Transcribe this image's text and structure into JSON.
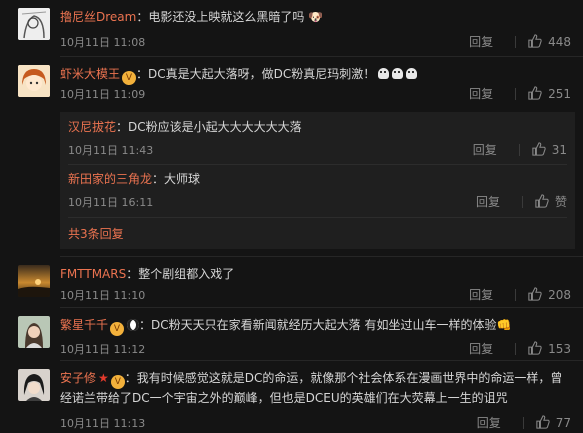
{
  "comments": [
    {
      "username": "撸尼丝Dream",
      "separator": "：",
      "text": "电影还没上映就这么黑暗了吗",
      "time": "10月11日 11:08",
      "reply_label": "回复",
      "likes": "448",
      "avatar_icon": "sketch-portrait-avatar"
    },
    {
      "username": "虾米大模王",
      "separator": "：",
      "text": "DC真是大起大落呀，做DC粉真尼玛刺激！",
      "time": "10月11日 11:09",
      "reply_label": "回复",
      "likes": "251",
      "avatar_icon": "cartoon-girl-avatar",
      "replies": [
        {
          "username": "汉尼拔花",
          "separator": "：",
          "text": "DC粉应该是小起大大大大大大落",
          "time": "10月11日 11:43",
          "reply_label": "回复",
          "likes": "31"
        },
        {
          "username": "新田家的三角龙",
          "separator": "：",
          "text": "大师球",
          "time": "10月11日 16:11",
          "reply_label": "回复",
          "likes": "赞"
        }
      ],
      "more_replies": "共3条回复"
    },
    {
      "username": "FMTTMARS",
      "separator": "：",
      "text": "整个剧组都入戏了",
      "time": "10月11日 11:10",
      "reply_label": "回复",
      "likes": "208",
      "avatar_icon": "sunset-landscape-avatar"
    },
    {
      "username": "繁星千千",
      "separator": "：",
      "text": "DC粉天天只在家看新闻就经历大起大落 有如坐过山车一样的体验",
      "time": "10月11日 11:12",
      "reply_label": "回复",
      "likes": "153",
      "avatar_icon": "woman-portrait-avatar"
    },
    {
      "username": "安子修",
      "separator": "：",
      "text": "我有时候感觉这就是DC的命运，就像那个社会体系在漫画世界中的命运一样，曾",
      "text2": "经诺兰带给了DC一个宇宙之外的巅峰，但也是DCEU的英雄们在大荧幕上一生的诅咒",
      "time": "10月11日 11:13",
      "reply_label": "回复",
      "likes": "77",
      "avatar_icon": "dark-hair-portrait-avatar"
    }
  ],
  "colors": {
    "username": "#eb7350",
    "background": "#141414",
    "subbox": "#1f1f1f",
    "meta": "#8a8a8a"
  }
}
